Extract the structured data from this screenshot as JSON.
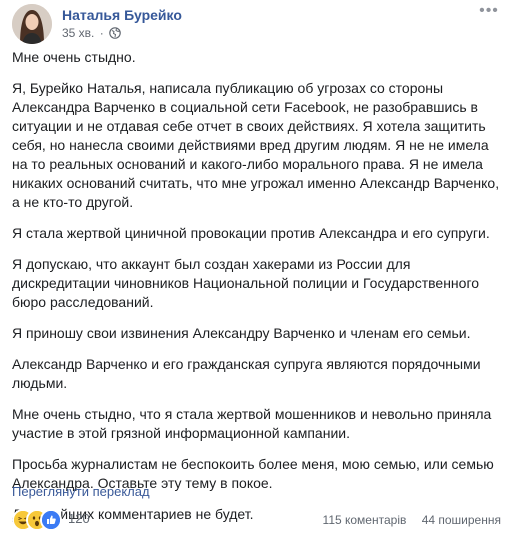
{
  "post": {
    "author": "Наталья Бурейко",
    "time": "35 хв.",
    "paragraphs": [
      "Мне очень стыдно.",
      "Я, Бурейко Наталья, написала публикацию об угрозах со стороны Александра Варченко в социальной сети Facebook, не разобравшись в ситуации и не отдавая себе отчет в своих действиях. Я хотела защитить себя, но нанесла своими действиями вред другим людям. Я не не имела на то реальных оснований и какого-либо морального права. Я не имела никаких оснований считать, что мне угрожал именно Александр Варченко, а не кто-то другой.",
      "Я стала жертвой циничной провокации против Александра и его супруги.",
      "Я допускаю, что аккаунт был создан хакерами из России для дискредитации чиновников Национальной полиции и Государственного бюро расследований.",
      "Я приношу свои извинения Александру Варченко и членам его семьи.",
      "Александр Варченко и его гражданская супруга являются порядочными людьми.",
      "Мне очень стыдно, что я стала жертвой мошенников и невольно приняла участие в этой грязной информационной кампании.",
      "Просьба журналистам не беспокоить более меня, мою семью, или семью Александра. Оставьте эту тему в покое.",
      "Дальнейших комментариев не будет."
    ],
    "see_translation": "Переглянути переклад"
  },
  "footer": {
    "reactions": [
      "haha-icon",
      "wow-icon",
      "like-icon"
    ],
    "reaction_count": "120",
    "comments": "115 коментарів",
    "shares": "44 поширення"
  },
  "colors": {
    "link": "#365899",
    "text": "#1c1e21",
    "meta": "#616770"
  }
}
